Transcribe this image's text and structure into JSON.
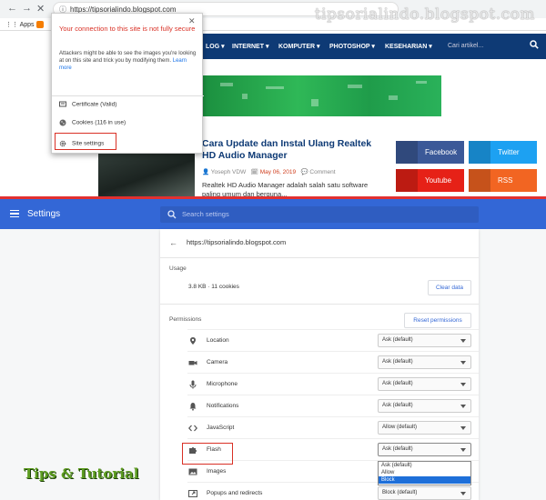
{
  "browser": {
    "url": "https://tipsorialindo.blogspot.com",
    "bookmarks": {
      "apps_label": "Apps"
    },
    "back_glyph": "←",
    "forward_glyph": "→",
    "reload_glyph": "✕"
  },
  "watermark": "tipsorialindo.blogspot.com",
  "site": {
    "nav": [
      "LOG ▾",
      "INTERNET ▾",
      "KOMPUTER ▾",
      "PHOTOSHOP ▾",
      "KESEHARIAN ▾"
    ],
    "search_placeholder": "Cari artikel...",
    "article": {
      "title": "Cara Update dan Instal Ulang Realtek HD Audio Manager",
      "author": "Yoseph VDW",
      "date": "May 06, 2019",
      "comment": "Comment",
      "snippet": "Realtek HD Audio Manager adalah salah satu software paling umum dan berguna..."
    },
    "social": [
      {
        "label": "Facebook",
        "color": "#3b5998"
      },
      {
        "label": "Twitter",
        "color": "#1da1f2"
      },
      {
        "label": "Youtube",
        "color": "#e62117"
      },
      {
        "label": "RSS",
        "color": "#f26522"
      }
    ]
  },
  "popup": {
    "warning_title": "Your connection to this site is not fully secure",
    "warning_body": "Attackers might be able to see the images you're looking at on this site and trick you by modifying them.",
    "learn_more": "Learn more",
    "certificate": "Certificate (Valid)",
    "cookies": "Cookies (116 in use)",
    "site_settings": "Site settings"
  },
  "settings": {
    "header_title": "Settings",
    "search_placeholder": "Search settings",
    "site_url": "https://tipsorialindo.blogspot.com",
    "usage_title": "Usage",
    "usage_text": "3.8 KB · 11 cookies",
    "clear_data": "Clear data",
    "permissions_title": "Permissions",
    "reset_permissions": "Reset permissions",
    "permissions": [
      {
        "label": "Location",
        "value": "Ask (default)",
        "icon": "location-icon"
      },
      {
        "label": "Camera",
        "value": "Ask (default)",
        "icon": "camera-icon"
      },
      {
        "label": "Microphone",
        "value": "Ask (default)",
        "icon": "microphone-icon"
      },
      {
        "label": "Notifications",
        "value": "Ask (default)",
        "icon": "bell-icon"
      },
      {
        "label": "JavaScript",
        "value": "Allow (default)",
        "icon": "code-icon"
      },
      {
        "label": "Flash",
        "value": "Ask (default)",
        "icon": "puzzle-icon"
      },
      {
        "label": "Images",
        "value": "",
        "icon": "image-icon"
      },
      {
        "label": "Popups and redirects",
        "value": "Block (default)",
        "icon": "popup-icon"
      }
    ],
    "flash_options": [
      "Ask (default)",
      "Allow",
      "Block"
    ],
    "flash_highlighted": "Block"
  },
  "logo_text": "Tips & Tutorial"
}
